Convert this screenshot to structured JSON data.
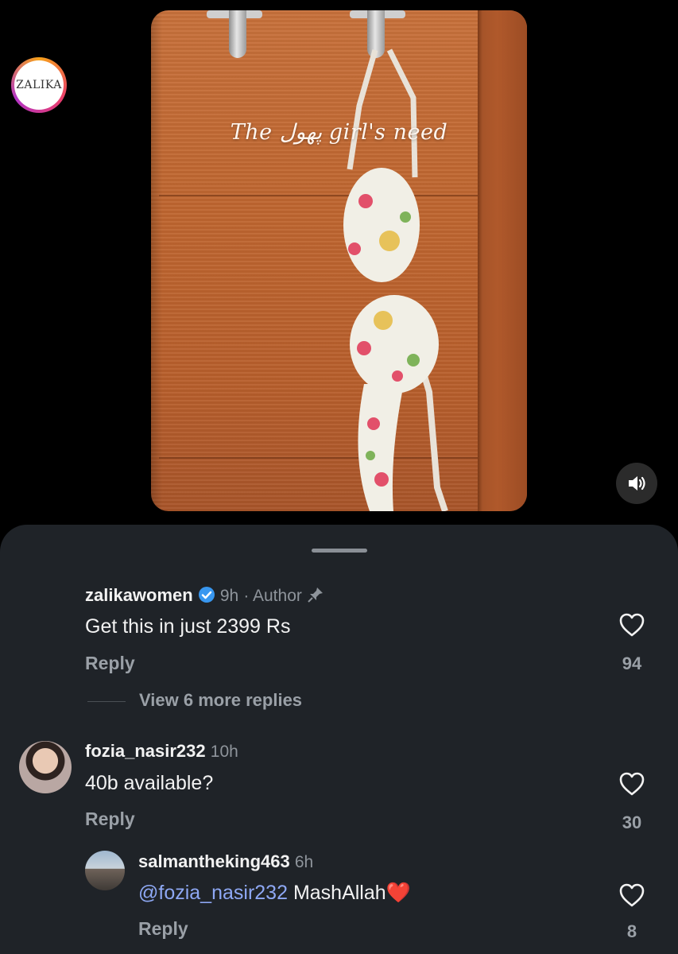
{
  "video": {
    "overlay_text": "The پھول girl's need",
    "sound_icon": "speaker-icon"
  },
  "comments": [
    {
      "username": "zalikawomen",
      "avatar_text": "ZALIKA",
      "verified": true,
      "time": "9h",
      "author_label": "· Author",
      "pinned": true,
      "text": "Get this in just 2399 Rs",
      "reply_label": "Reply",
      "likes": "94",
      "view_more": "View 6 more replies"
    },
    {
      "username": "fozia_nasir232",
      "time": "10h",
      "text": "40b available?",
      "reply_label": "Reply",
      "likes": "30"
    },
    {
      "username": "salmantheking463",
      "time": "6h",
      "mention": "@fozia_nasir232",
      "text": " MashAllah❤️",
      "reply_label": "Reply",
      "likes": "8"
    }
  ],
  "colors": {
    "sheet_bg": "#1f2328",
    "verified": "#3897f0",
    "mention": "#8ea8f4"
  }
}
